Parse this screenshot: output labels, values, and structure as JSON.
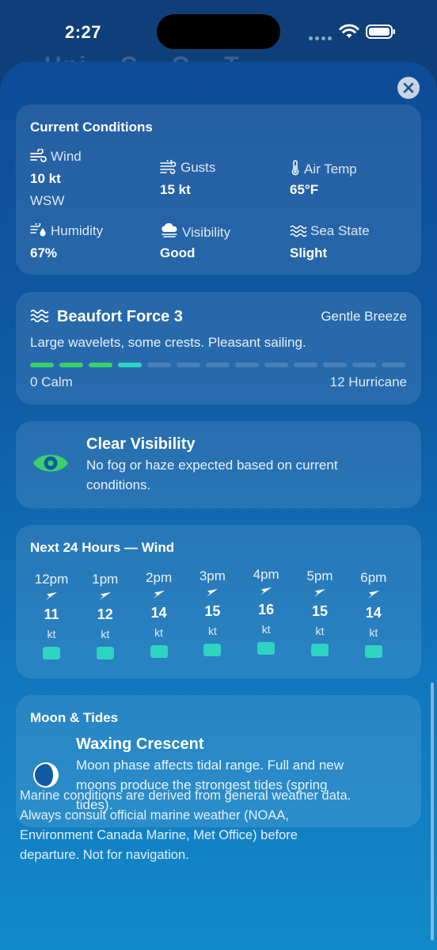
{
  "status_bar": {
    "time": "2:27"
  },
  "background_title": "Uni... C... O... T...",
  "current_conditions": {
    "title": "Current Conditions",
    "wind": {
      "label": "Wind",
      "value": "10 kt",
      "direction": "WSW",
      "icon": "wind-icon"
    },
    "gusts": {
      "label": "Gusts",
      "value": "15 kt",
      "icon": "gusts-icon"
    },
    "air_temp": {
      "label": "Air Temp",
      "value": "65°F",
      "icon": "thermometer-icon"
    },
    "humidity": {
      "label": "Humidity",
      "value": "67%",
      "icon": "humidity-icon"
    },
    "visibility": {
      "label": "Visibility",
      "value": "Good",
      "icon": "cloud-fog-icon"
    },
    "sea_state": {
      "label": "Sea State",
      "value": "Slight",
      "icon": "waves-icon"
    }
  },
  "beaufort": {
    "title": "Beaufort Force 3",
    "name": "Gentle Breeze",
    "description": "Large wavelets, some crests. Pleasant sailing.",
    "scale_min_label": "0 Calm",
    "scale_max_label": "12 Hurricane",
    "force": 3,
    "max_force": 12,
    "colors": {
      "calm": "#3ad16b",
      "active": "#2fd3c1",
      "inactive": "rgba(255,255,255,0.15)"
    }
  },
  "visibility_card": {
    "title": "Clear Visibility",
    "description_line1": "No fog or haze expected based on current",
    "description_line2": "conditions.",
    "icon": "eye-icon",
    "icon_color": "#3ad16b"
  },
  "forecast": {
    "title": "Next 24 Hours — Wind",
    "unit": "kt",
    "hours": [
      {
        "time": "12pm",
        "speed": "11"
      },
      {
        "time": "1pm",
        "speed": "12"
      },
      {
        "time": "2pm",
        "speed": "14"
      },
      {
        "time": "3pm",
        "speed": "15"
      },
      {
        "time": "4pm",
        "speed": "16"
      },
      {
        "time": "5pm",
        "speed": "15"
      },
      {
        "time": "6pm",
        "speed": "14"
      }
    ]
  },
  "moon": {
    "title": "Moon & Tides",
    "phase": "Waxing Crescent",
    "description_line1": "Moon phase affects tidal range. Full and new",
    "description_line2": "moons produce the strongest tides (spring",
    "description_line3": "tides).",
    "icon": "moon-icon"
  },
  "disclaimer": {
    "line1": "Marine conditions are derived from general weather data.",
    "line2": "Always consult official marine weather (NOAA,",
    "line3": "Environment Canada Marine, Met Office) before",
    "line4": "departure. Not for navigation."
  }
}
